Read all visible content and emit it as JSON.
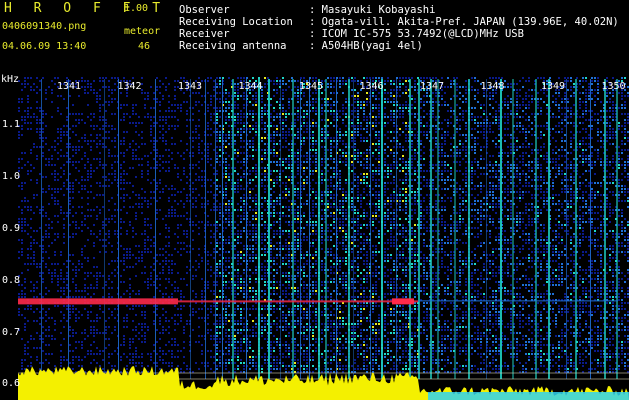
{
  "header": {
    "app_title": "H R O F F T",
    "version": "1.00",
    "filename": "0406091340.png",
    "meteor_label": "meteor",
    "datetime": "04.06.09 13:40",
    "meteor_count": "46"
  },
  "station_info": [
    {
      "label": "Observer",
      "value": ": Masayuki Kobayashi"
    },
    {
      "label": "Receiving Location",
      "value": ": Ogata-vill. Akita-Pref. JAPAN (139.96E, 40.02N)"
    },
    {
      "label": "Receiver",
      "value": ": ICOM IC-575 53.7492(@LCD)MHz USB"
    },
    {
      "label": "Receiving antenna",
      "value": ": A504HB(yagi 4el)"
    }
  ],
  "chart_data": {
    "type": "heatmap",
    "ylabel": "kHz",
    "y_ticks": [
      "1.1",
      "1.0",
      "0.9",
      "0.8",
      "0.7",
      "0.6"
    ],
    "ylim": [
      0.57,
      1.2
    ],
    "x_ticks": [
      "1341",
      "1342",
      "1343",
      "1344",
      "1345",
      "1346",
      "1347",
      "1348",
      "1349",
      "1350"
    ],
    "carrier_khz": 0.76,
    "colors": {
      "background": "#000000",
      "noise_low": "#0a1a8a",
      "noise_mid": "#1f6fd6",
      "noise_high": "#1fd6c8",
      "hot": "#e8e820",
      "carrier": "#ff2a4a",
      "activity": "#f4f000",
      "activity_cutoff": "#2fd4f0",
      "guide_line": "#d8d0b0"
    }
  }
}
